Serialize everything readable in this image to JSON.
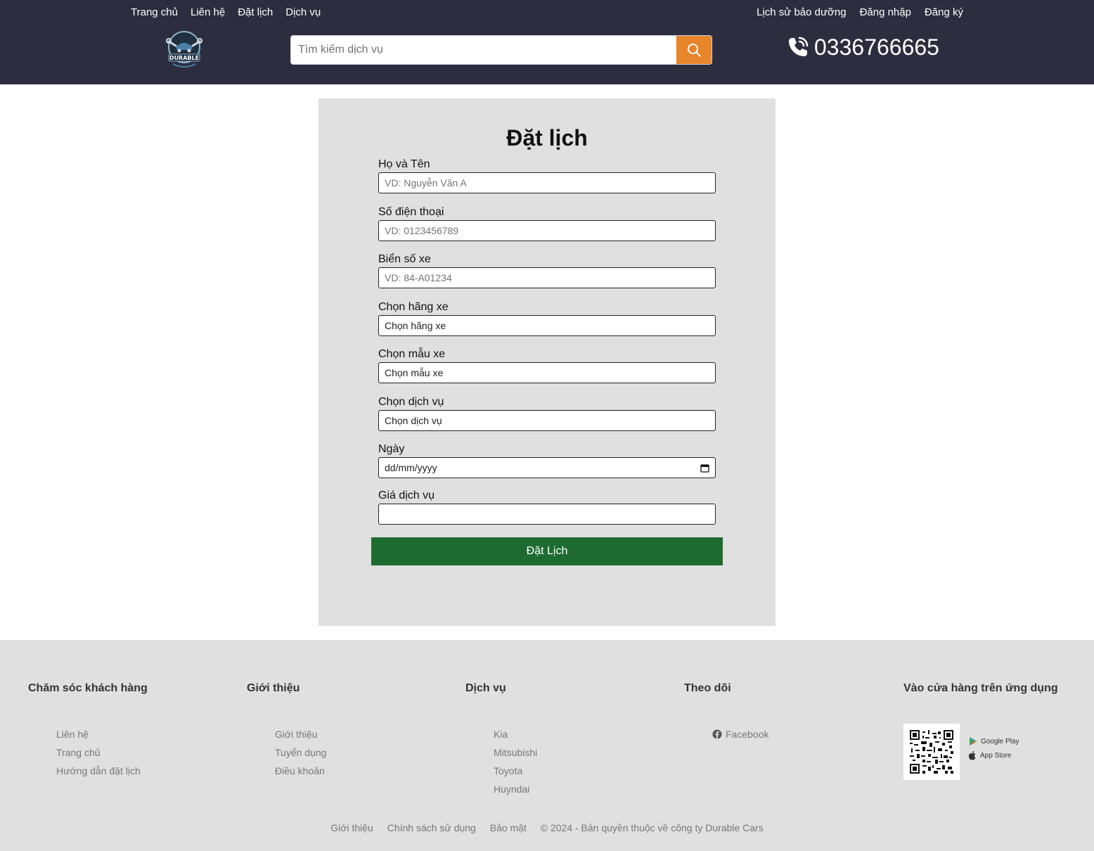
{
  "header": {
    "nav_left": [
      "Trang chủ",
      "Liên hệ",
      "Đặt lịch",
      "Dịch vụ"
    ],
    "nav_right": [
      "Lịch sử bảo dưỡng",
      "Đăng nhập",
      "Đăng ký"
    ],
    "logo_text": "DURABLE",
    "search_placeholder": "Tìm kiếm dịch vụ",
    "phone": "0336766665",
    "accent_color": "#e8852a"
  },
  "form": {
    "title": "Đặt lịch",
    "fields": [
      {
        "label": "Họ và Tên",
        "placeholder": "VD: Nguyễn Văn A"
      },
      {
        "label": "Số điện thoại",
        "placeholder": "VD: 0123456789"
      },
      {
        "label": "Biển số xe",
        "placeholder": "VD: 84-A01234"
      },
      {
        "label": "Chọn hãng xe",
        "value": "Chọn hãng xe"
      },
      {
        "label": "Chọn mẫu xe",
        "value": "Chọn mẫu xe"
      },
      {
        "label": "Chọn dịch vụ",
        "value": "Chọn dịch vụ"
      },
      {
        "label": "Ngày",
        "value": "dd/mm/yyyy"
      },
      {
        "label": "Giá dịch vụ",
        "value": ""
      }
    ],
    "submit_label": "Đặt Lịch",
    "submit_color": "#1e6b32"
  },
  "footer": {
    "columns": [
      {
        "title": "Chăm sóc khách hàng",
        "items": [
          "Liên hệ",
          "Trang chủ",
          "Hướng dẫn đặt lịch"
        ]
      },
      {
        "title": "Giới thiệu",
        "items": [
          "Giới thiệu",
          "Tuyển dụng",
          "Điều khoản"
        ]
      },
      {
        "title": "Dịch vụ",
        "items": [
          "Kia",
          "Mitsubishi",
          "Toyota",
          "Huyndai"
        ]
      },
      {
        "title": "Theo dõi",
        "items": [
          "Facebook"
        ]
      },
      {
        "title": "Vào cửa hàng trên ứng dụng",
        "items": []
      }
    ],
    "stores": [
      "Google Play",
      "App Store"
    ],
    "bottom": [
      "Giới thiệu",
      "Chính sách sử dụng",
      "Bảo mật",
      "© 2024 - Bản quyền thuộc về công ty Durable Cars"
    ]
  }
}
